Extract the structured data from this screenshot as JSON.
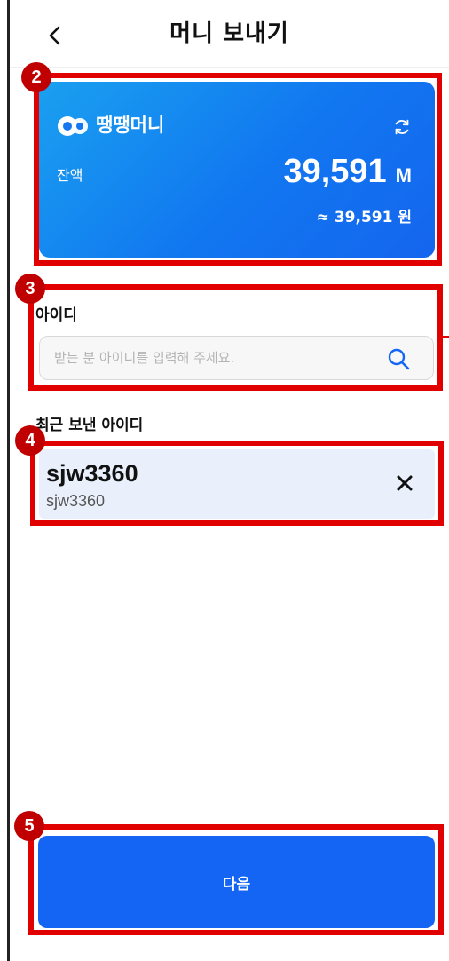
{
  "header": {
    "title": "머니 보내기",
    "back_icon": "chevron-left-icon"
  },
  "badges": [
    "2",
    "3",
    "4",
    "5"
  ],
  "wallet_card": {
    "brand": "땡땡머니",
    "logo_icon": "brand-logo-icon",
    "refresh_icon": "refresh-icon",
    "balance_label": "잔액",
    "amount": "39,591",
    "unit": "M",
    "krw_equivalent": "≈ 39,591  원",
    "gradient_start": "#1aa0f0",
    "gradient_end": "#1565ee"
  },
  "recipient": {
    "label": "아이디",
    "placeholder": "받는 분 아이디를 입력해 주세요.",
    "value": "",
    "search_icon": "search-icon"
  },
  "recent": {
    "label": "최근 보낸 아이디",
    "items": [
      {
        "id": "sjw3360",
        "sub": "sjw3360",
        "remove_icon": "close-icon"
      }
    ]
  },
  "next_button": {
    "label": "다음",
    "color": "#1565f5"
  },
  "highlight_color": "#e00000"
}
